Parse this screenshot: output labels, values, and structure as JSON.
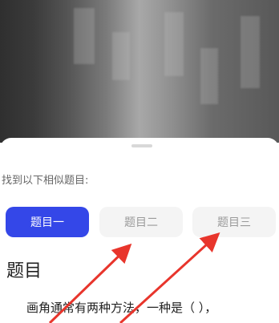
{
  "prompt_text": "找到以下相似题目:",
  "tabs": [
    {
      "label": "题目一",
      "active": true
    },
    {
      "label": "题目二",
      "active": false
    },
    {
      "label": "题目三",
      "active": false
    }
  ],
  "section_heading": "题目",
  "question_text": "画角通常有两种方法，一种是（   ），",
  "colors": {
    "accent": "#3447e8",
    "arrow": "#e8352c"
  }
}
